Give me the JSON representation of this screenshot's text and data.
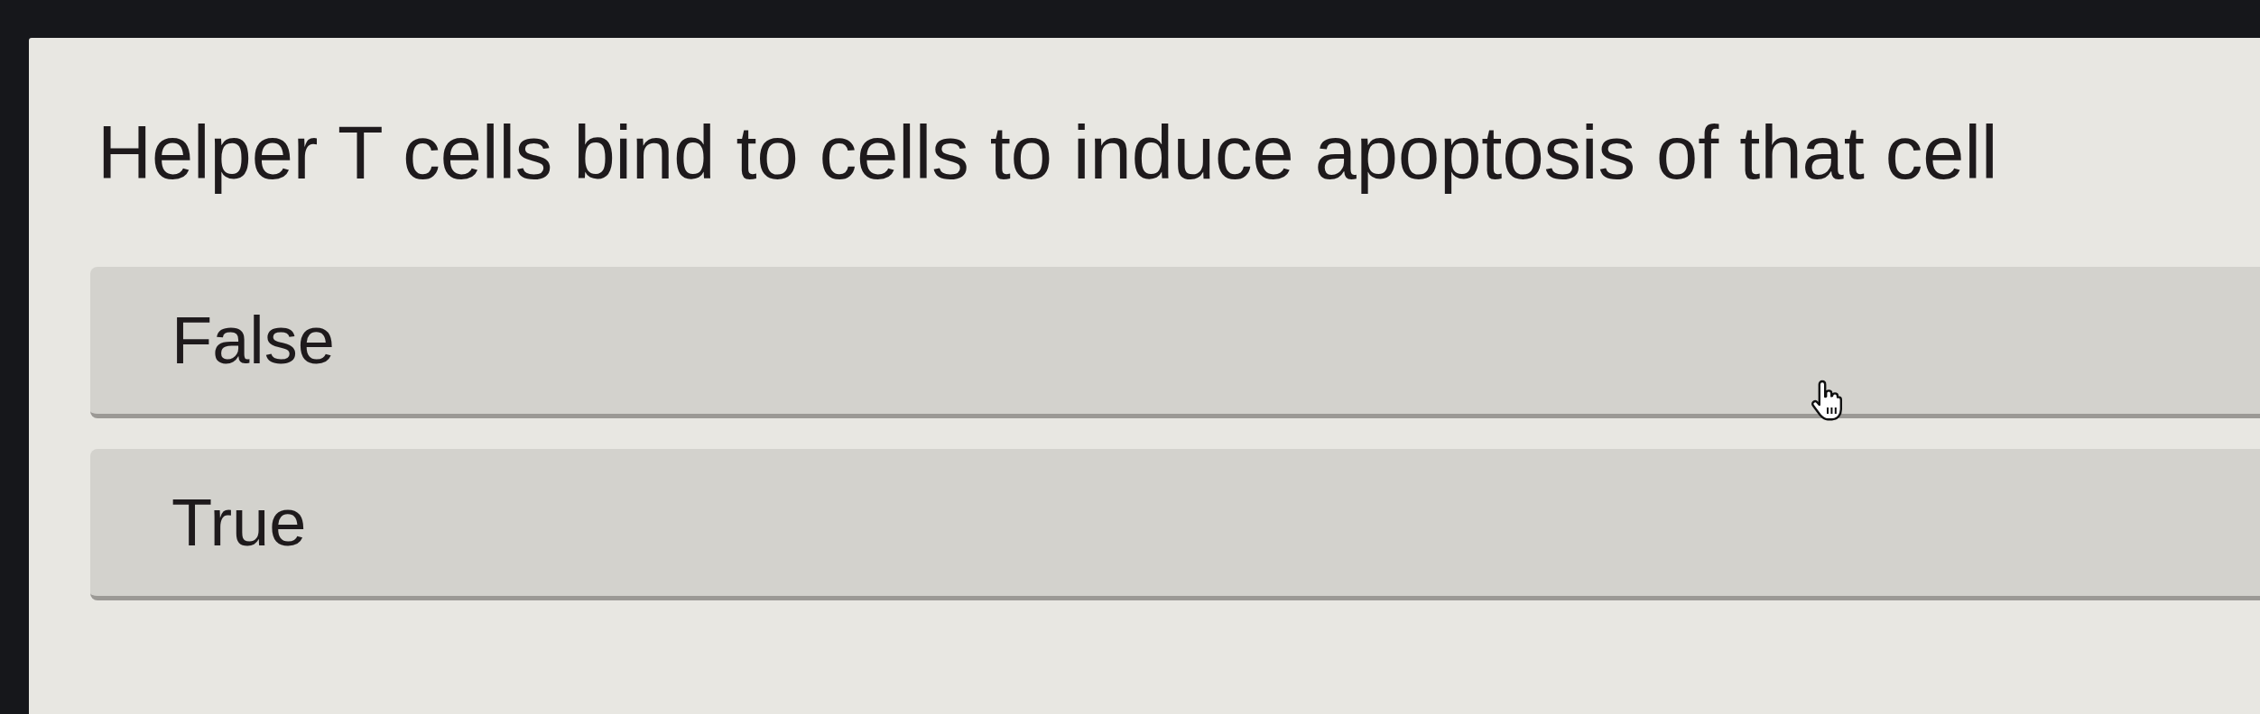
{
  "question": {
    "text": "Helper T cells bind to cells to induce apoptosis of that cell"
  },
  "options": [
    {
      "label": "False",
      "selected": false
    },
    {
      "label": "True",
      "selected": false
    }
  ]
}
